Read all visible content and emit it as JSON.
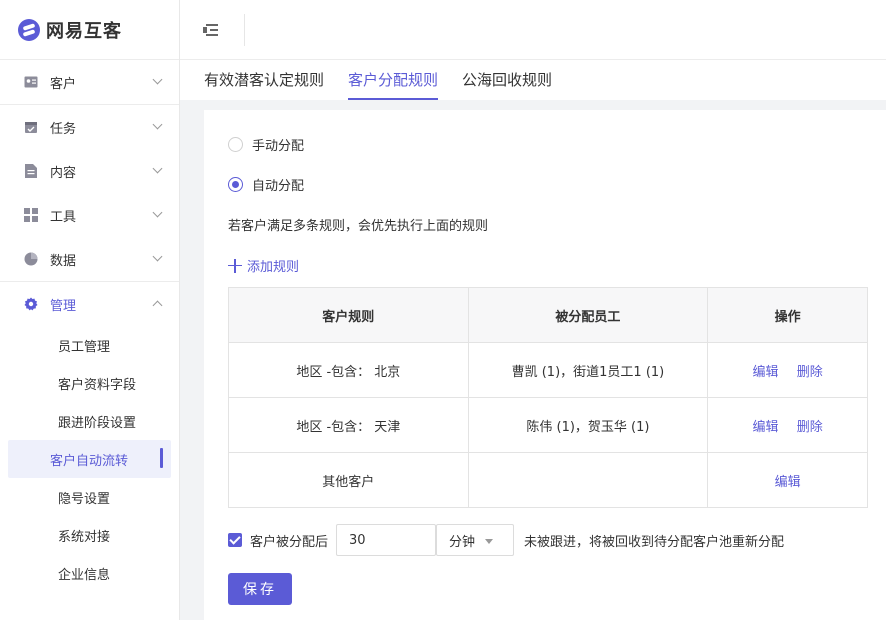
{
  "app": {
    "name": "网易互客"
  },
  "sidebar": {
    "groups": [
      {
        "label": "客户",
        "icon": "contact-card-icon"
      },
      {
        "label": "任务",
        "icon": "calendar-check-icon"
      },
      {
        "label": "内容",
        "icon": "document-icon"
      },
      {
        "label": "工具",
        "icon": "grid-icon"
      },
      {
        "label": "数据",
        "icon": "pie-chart-icon"
      }
    ],
    "manage": {
      "label": "管理",
      "icon": "gear-icon",
      "items": [
        "员工管理",
        "客户资料字段",
        "跟进阶段设置",
        "客户自动流转",
        "隐号设置",
        "系统对接",
        "企业信息"
      ],
      "selected": "客户自动流转"
    }
  },
  "tabs": [
    {
      "label": "有效潜客认定规则"
    },
    {
      "label": "客户分配规则"
    },
    {
      "label": "公海回收规则"
    }
  ],
  "active_tab": "客户分配规则",
  "assign": {
    "manual_label": "手动分配",
    "auto_label": "自动分配",
    "hint": "若客户满足多条规则，会优先执行上面的规则",
    "add_rule": "添加规则"
  },
  "table": {
    "headers": [
      "客户规则",
      "被分配员工",
      "操作"
    ],
    "rows": [
      {
        "rule": "地区 -包含： 北京",
        "staff": "曹凯 (1)，街道1员工1 (1)",
        "edit": "编辑",
        "delete": "删除"
      },
      {
        "rule": "地区 -包含： 天津",
        "staff": "陈伟 (1)，贺玉华 (1)",
        "edit": "编辑",
        "delete": "删除"
      },
      {
        "rule": "其他客户",
        "staff": "",
        "edit": "编辑"
      }
    ]
  },
  "recycle": {
    "prefix": "客户被分配后",
    "value": "30",
    "unit": "分钟",
    "suffix": "未被跟进，将被回收到待分配客户池重新分配"
  },
  "save_label": "保存",
  "colors": {
    "accent": "#5b5bd6"
  }
}
